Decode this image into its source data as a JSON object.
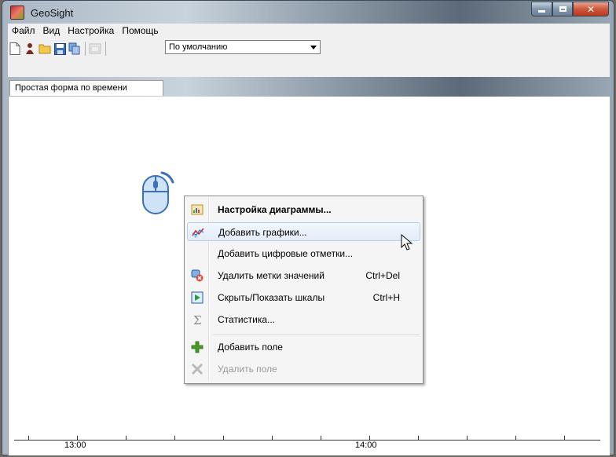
{
  "window": {
    "title": "GeoSight"
  },
  "menubar": {
    "items": [
      "Файл",
      "Вид",
      "Настройка",
      "Помощь"
    ]
  },
  "toolbar": {
    "icons": [
      "new-document-icon",
      "person-icon",
      "open-folder-icon",
      "save-icon",
      "copy-icon",
      "window-icon"
    ],
    "combo_value": "По умолчанию"
  },
  "tabs": [
    {
      "label": "Простая форма по времени"
    }
  ],
  "context_menu": {
    "items": [
      {
        "label": "Настройка диаграммы...",
        "shortcut": "",
        "icon": "chart-settings-icon",
        "bold": true
      },
      {
        "label": "Добавить графики...",
        "shortcut": "",
        "icon": "add-graphs-icon",
        "hover": true
      },
      {
        "label": "Добавить цифровые отметки...",
        "shortcut": "",
        "icon": ""
      },
      {
        "label": "Удалить метки значений",
        "shortcut": "Ctrl+Del",
        "icon": "delete-labels-icon"
      },
      {
        "label": "Скрыть/Показать шкалы",
        "shortcut": "Ctrl+H",
        "icon": "toggle-scales-icon"
      },
      {
        "label": "Статистика...",
        "shortcut": "",
        "icon": "sigma-icon"
      },
      {
        "label": "Добавить поле",
        "shortcut": "",
        "icon": "plus-icon"
      },
      {
        "label": "Удалить поле",
        "shortcut": "",
        "icon": "remove-icon",
        "disabled": true
      }
    ]
  },
  "axis": {
    "labels": [
      "13:00",
      "14:00"
    ]
  },
  "colors": {
    "accent": "#b7cfe9",
    "plus_green": "#4a9a2a",
    "disabled_text": "#9a9a9a"
  }
}
